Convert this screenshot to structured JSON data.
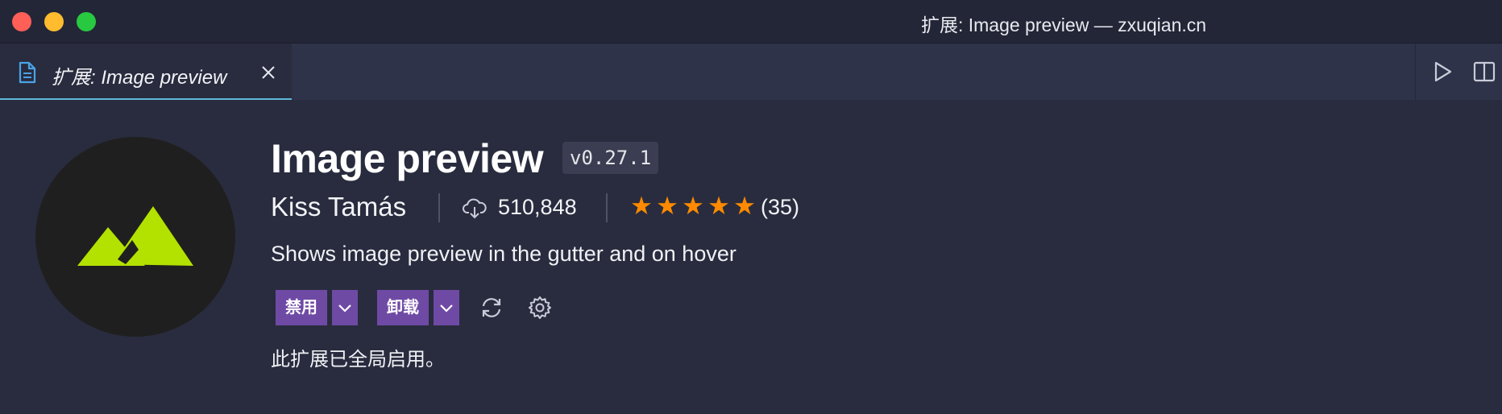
{
  "window": {
    "title": "扩展: Image preview — zxuqian.cn"
  },
  "tab": {
    "label": "扩展: Image preview",
    "icon": "file-icon",
    "close_icon": "close-icon"
  },
  "editor_actions": {
    "run_icon": "run-icon",
    "split_icon": "split-editor-icon"
  },
  "extension": {
    "name": "Image preview",
    "version": "v0.27.1",
    "publisher": "Kiss Tamás",
    "installs": "510,848",
    "rating_stars": 5,
    "rating_count": "(35)",
    "description": "Shows image preview in the gutter and on hover",
    "status": "此扩展已全局启用。",
    "logo_icon": "mountain-logo-icon"
  },
  "buttons": {
    "disable_label": "禁用",
    "uninstall_label": "卸载"
  },
  "colors": {
    "accent": "#6f4aa5",
    "star": "#ff8a00",
    "logo_green": "#b3e200",
    "tab_underline": "#5fb8d8"
  }
}
